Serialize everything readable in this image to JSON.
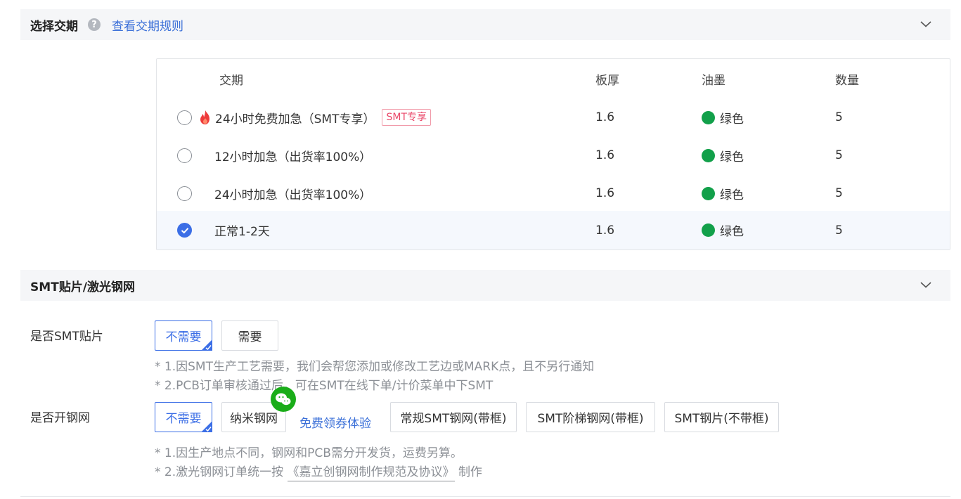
{
  "lead_section": {
    "title": "选择交期",
    "help_glyph": "?",
    "rules_link": "查看交期规则"
  },
  "lead_table": {
    "headers": {
      "name": "交期",
      "thickness": "板厚",
      "ink": "油墨",
      "quantity": "数量"
    },
    "rows": [
      {
        "name": "24小时免费加急（SMT专享）",
        "badge": "SMT专享",
        "thickness": "1.6",
        "ink": "绿色",
        "quantity": "5"
      },
      {
        "name": "12小时加急（出货率100%）",
        "thickness": "1.6",
        "ink": "绿色",
        "quantity": "5"
      },
      {
        "name": "24小时加急（出货率100%）",
        "thickness": "1.6",
        "ink": "绿色",
        "quantity": "5"
      },
      {
        "name": "正常1-2天",
        "thickness": "1.6",
        "ink": "绿色",
        "quantity": "5"
      }
    ],
    "selected_index": 3
  },
  "smt_section": {
    "title": "SMT贴片/激光钢网"
  },
  "smt_placement": {
    "label": "是否SMT贴片",
    "options": [
      "不需要",
      "需要"
    ],
    "selected": "不需要",
    "notes": [
      "* 1.因SMT生产工艺需要，我们会帮您添加或修改工艺边或MARK点，且不另行通知",
      "* 2.PCB订单审核通过后，可在SMT在线下单/计价菜单中下SMT"
    ]
  },
  "stencil": {
    "label": "是否开钢网",
    "options": [
      "不需要",
      "纳米钢网",
      "常规SMT钢网(带框)",
      "SMT阶梯钢网(带框)",
      "SMT钢片(不带框)"
    ],
    "selected": "不需要",
    "free_link": "免费领券体验",
    "note1": "* 1.因生产地点不同，钢网和PCB需分开发货，运费另算。",
    "note2_prefix": "* 2.激光钢网订单统一按",
    "note2_link": "《嘉立创钢网制作规范及协议》",
    "note2_suffix": "制作"
  },
  "colors": {
    "accent": "#3b6ee6",
    "link": "#3a6fd8",
    "ink_green": "#12a04a",
    "badge_red": "#ea4668",
    "wechat_green": "#1aad19"
  }
}
